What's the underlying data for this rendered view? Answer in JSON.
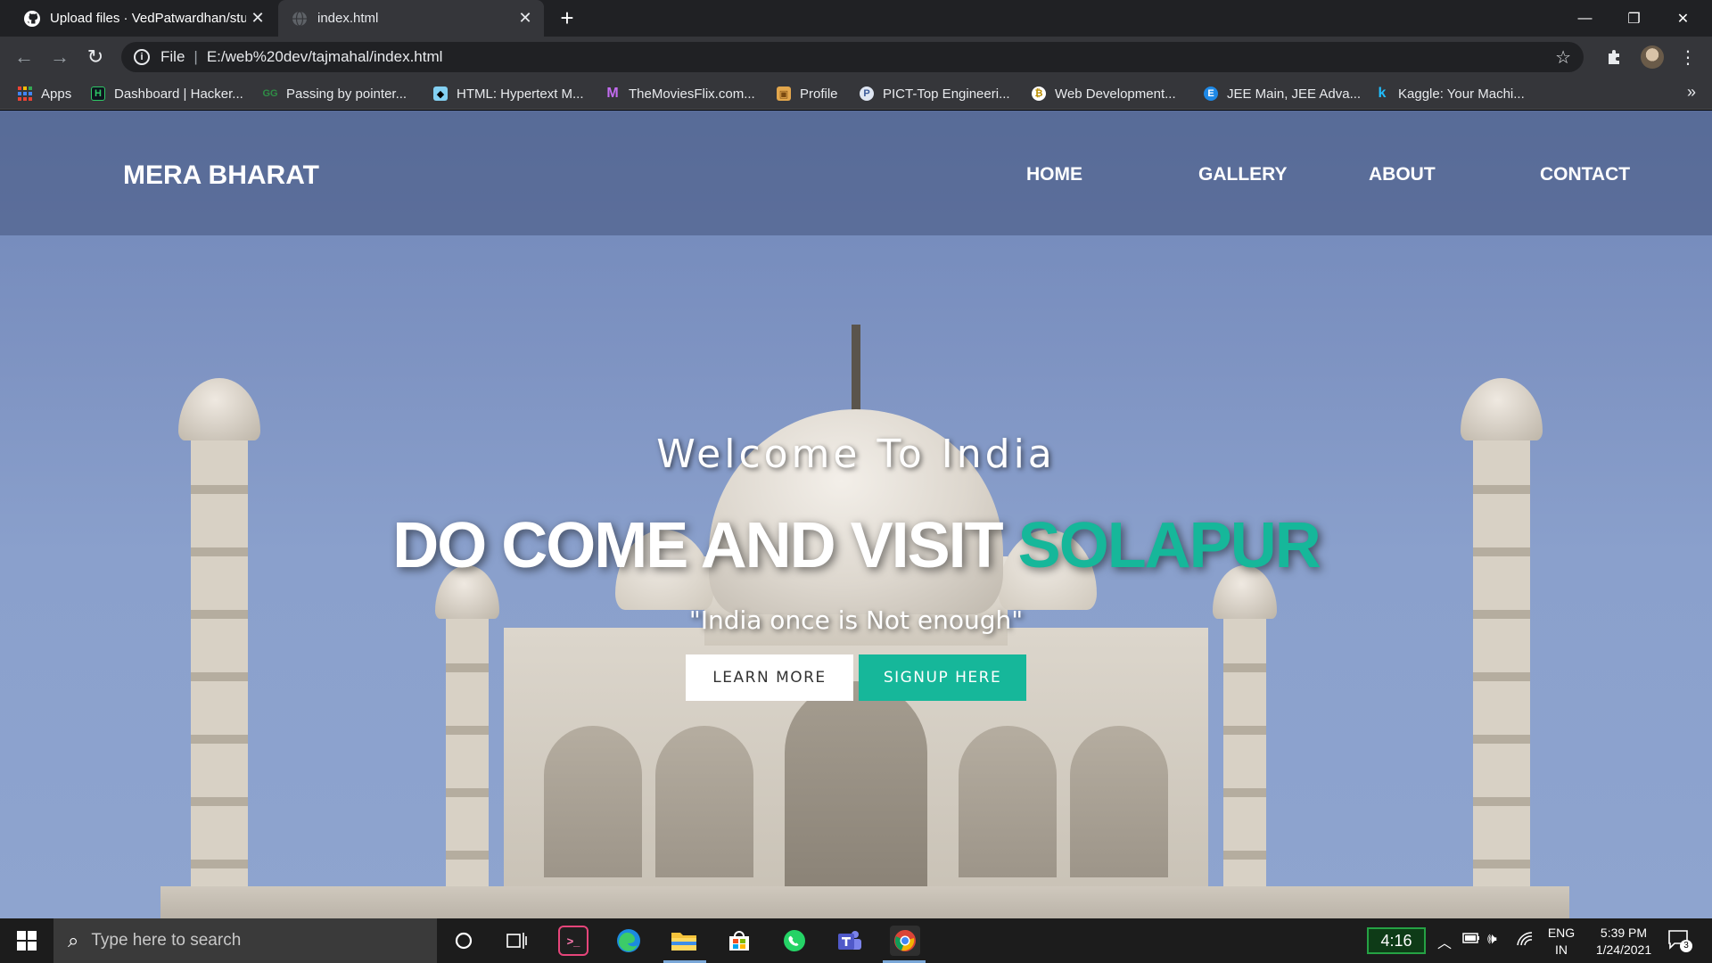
{
  "browser": {
    "tabs": [
      {
        "title": "Upload files · VedPatwardhan/stu",
        "icon": "github-icon"
      },
      {
        "title": "index.html",
        "icon": "globe-icon"
      }
    ],
    "new_tab": "+",
    "window_controls": {
      "minimize": "—",
      "restore": "❐",
      "close": "✕"
    },
    "omnibox": {
      "scheme": "File",
      "url": "E:/web%20dev/tajmahal/index.html"
    },
    "bookmarks": [
      {
        "label": "Apps",
        "icon": "apps-grid-icon"
      },
      {
        "label": "Dashboard | Hacker...",
        "icon": "hackerrank-icon"
      },
      {
        "label": "Passing by pointer...",
        "icon": "geeksforgeeks-icon"
      },
      {
        "label": "HTML: Hypertext M...",
        "icon": "mdn-icon"
      },
      {
        "label": "TheMoviesFlix.com...",
        "icon": "moviesflix-icon"
      },
      {
        "label": "Profile",
        "icon": "package-icon"
      },
      {
        "label": "PICT-Top Engineeri...",
        "icon": "pict-icon"
      },
      {
        "label": "Web Development...",
        "icon": "webdev-icon"
      },
      {
        "label": "JEE Main, JEE Adva...",
        "icon": "edu-icon"
      },
      {
        "label": "Kaggle: Your Machi...",
        "icon": "kaggle-icon"
      }
    ],
    "bookmarks_overflow": "»"
  },
  "site": {
    "brand": "MERA BHARAT",
    "nav": [
      "HOME",
      "GALLERY",
      "ABOUT",
      "CONTACT"
    ],
    "hero": {
      "welcome": "Welcome To India",
      "headline_main": "DO COME AND VISIT ",
      "headline_accent": "SOLAPUR",
      "tagline": "\"India once is Not enough\"",
      "learn_more": "LEARN MORE",
      "signup": "SIGNUP HERE"
    },
    "colors": {
      "accent": "#16b79a"
    }
  },
  "taskbar": {
    "search_placeholder": "Type here to search",
    "battery_widget": "4:16",
    "language": {
      "line1": "ENG",
      "line2": "IN"
    },
    "time": "5:39 PM",
    "date": "1/24/2021",
    "notifications": "3"
  }
}
